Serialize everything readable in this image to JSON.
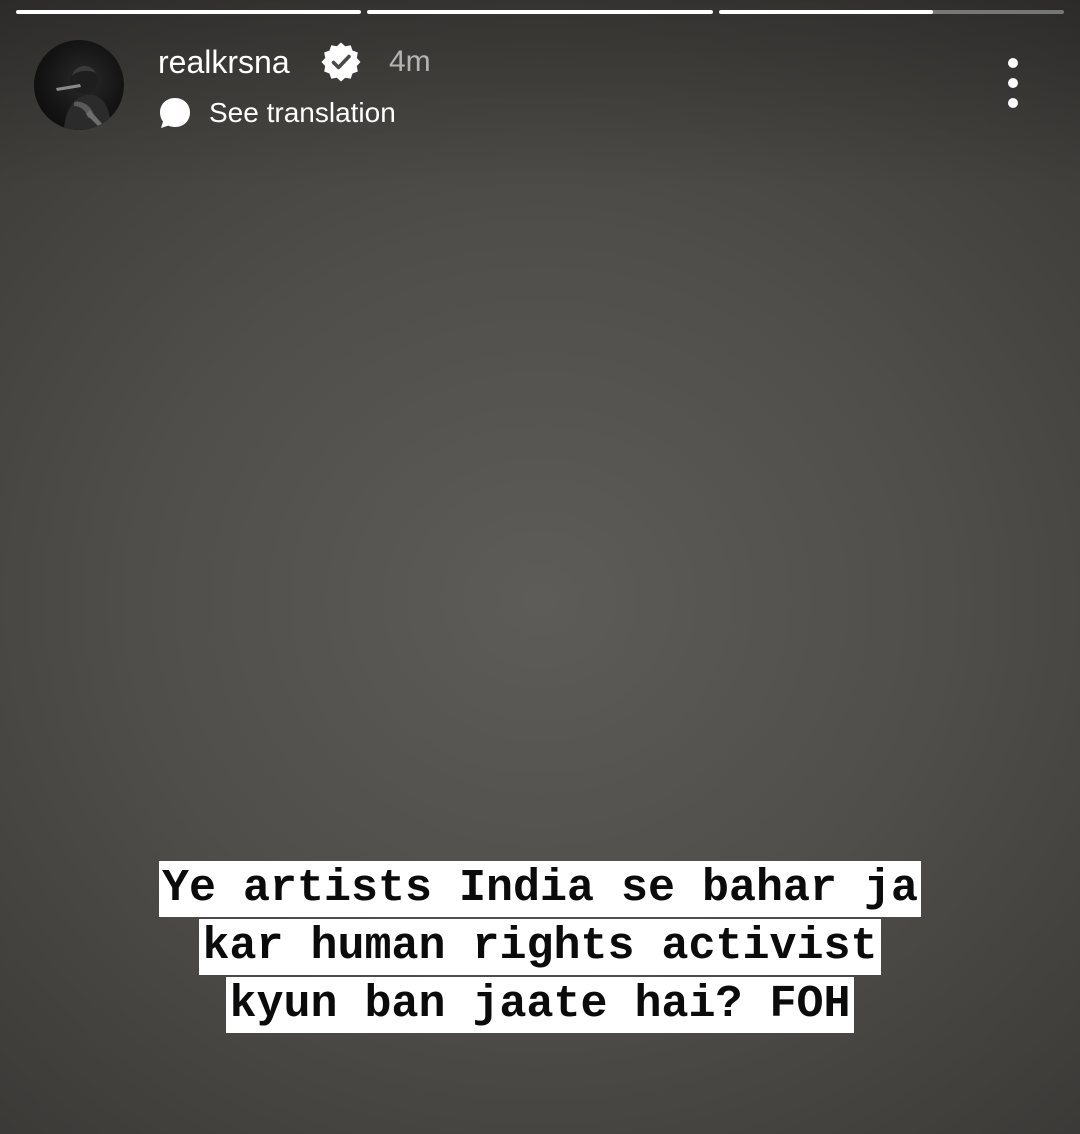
{
  "progress": {
    "segments": [
      {
        "fill": 1.0
      },
      {
        "fill": 1.0
      },
      {
        "fill": 0.62
      }
    ]
  },
  "header": {
    "username": "realkrsna",
    "verified": true,
    "timestamp": "4m",
    "see_translation_label": "See translation",
    "avatar_icon": "profile-photo",
    "verified_icon": "verified-badge-icon",
    "translation_icon": "speech-bubble-icon",
    "more_icon": "more-vertical-icon"
  },
  "caption": {
    "lines": [
      "Ye artists India se bahar ja",
      "kar human rights activist",
      "kyun ban jaate hai? FOH"
    ]
  },
  "colors": {
    "caption_background": "#ffffff",
    "caption_text": "#0b0b0b",
    "story_background": "#504e4a"
  }
}
